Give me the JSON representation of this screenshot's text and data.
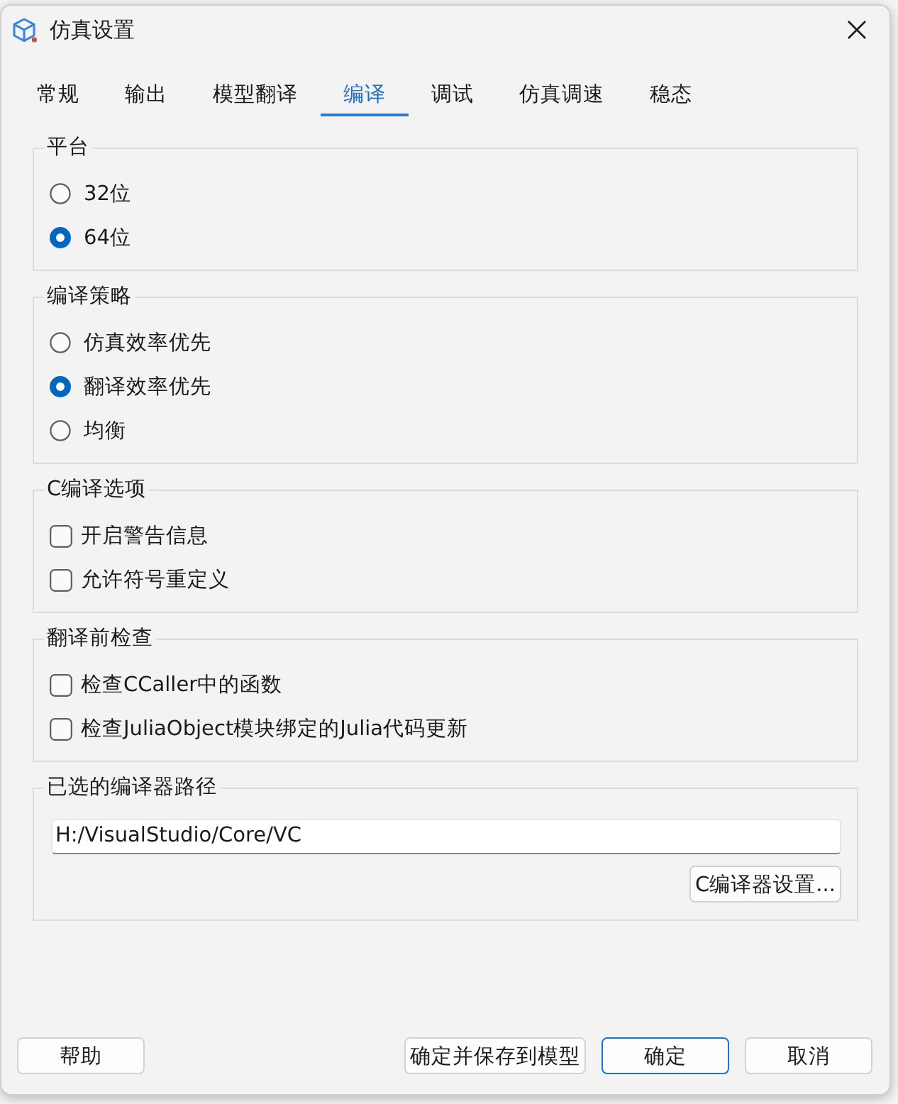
{
  "window": {
    "title": "仿真设置"
  },
  "tabs": [
    {
      "label": "常规",
      "selected": false
    },
    {
      "label": "输出",
      "selected": false
    },
    {
      "label": "模型翻译",
      "selected": false
    },
    {
      "label": "编译",
      "selected": true
    },
    {
      "label": "调试",
      "selected": false
    },
    {
      "label": "仿真调速",
      "selected": false
    },
    {
      "label": "稳态",
      "selected": false
    }
  ],
  "groups": [
    {
      "title": "平台",
      "items": [
        {
          "kind": "radio",
          "label": "32位",
          "selected": false
        },
        {
          "kind": "radio",
          "label": "64位",
          "selected": true
        }
      ]
    },
    {
      "title": "编译策略",
      "items": [
        {
          "kind": "radio",
          "label": "仿真效率优先",
          "selected": false
        },
        {
          "kind": "radio",
          "label": "翻译效率优先",
          "selected": true
        },
        {
          "kind": "radio",
          "label": "均衡",
          "selected": false
        }
      ]
    },
    {
      "title": "C编译选项",
      "items": [
        {
          "kind": "checkbox",
          "label": "开启警告信息",
          "checked": false
        },
        {
          "kind": "checkbox",
          "label": "允许符号重定义",
          "checked": false
        }
      ]
    },
    {
      "title": "翻译前检查",
      "items": [
        {
          "kind": "checkbox",
          "label": "检查CCaller中的函数",
          "checked": false
        },
        {
          "kind": "checkbox",
          "label": "检查JuliaObject模块绑定的Julia代码更新",
          "checked": false
        }
      ]
    },
    {
      "title": "已选的编译器路径",
      "items": [
        {
          "kind": "path",
          "value": "H:/VisualStudio/Core/VC"
        },
        {
          "kind": "button",
          "label": "C编译器设置..."
        }
      ]
    }
  ],
  "footer": {
    "left_buttons": [
      {
        "label": "帮助",
        "default": false
      }
    ],
    "right_buttons": [
      {
        "label": "确定并保存到模型",
        "default": false
      },
      {
        "label": "确定",
        "default": true
      },
      {
        "label": "取消",
        "default": false
      }
    ]
  }
}
